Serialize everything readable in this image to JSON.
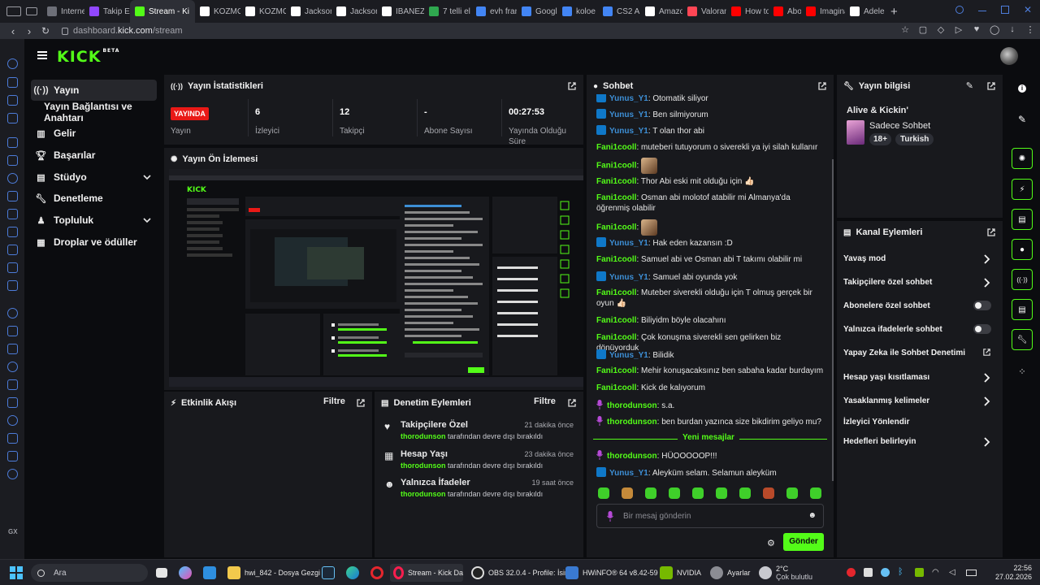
{
  "browser": {
    "tabs": [
      {
        "label": "Internet",
        "color": "#6d6f78"
      },
      {
        "label": "Takip Ed",
        "color": "#9147ff"
      },
      {
        "label": "Stream - Ki",
        "color": "#53fc18"
      },
      {
        "label": "KOZMO",
        "color": "#ffffff"
      },
      {
        "label": "KOZMO",
        "color": "#ffffff"
      },
      {
        "label": "Jackson",
        "color": "#ffffff"
      },
      {
        "label": "Jackson",
        "color": "#ffffff"
      },
      {
        "label": "IBANEZ",
        "color": "#ffffff"
      },
      {
        "label": "7 telli el",
        "color": "#2fa84f"
      },
      {
        "label": "evh fran",
        "color": "#4285f4"
      },
      {
        "label": "Google",
        "color": "#4285f4"
      },
      {
        "label": "koloe -",
        "color": "#4285f4"
      },
      {
        "label": "CS2 All",
        "color": "#4285f4"
      },
      {
        "label": "Amazon",
        "color": "#ffffff"
      },
      {
        "label": "Valorant",
        "color": "#ff4655"
      },
      {
        "label": "How to",
        "color": "#ff0000"
      },
      {
        "label": "Abo",
        "color": "#ff0000"
      },
      {
        "label": "Imagina",
        "color": "#ff0000"
      },
      {
        "label": "Adele -",
        "color": "#ffffff"
      }
    ],
    "url_prefix": "dashboard.",
    "url_domain": "kick.com",
    "url_path": "/stream"
  },
  "header": {
    "logo": "KICK",
    "logo_beta": "BETA"
  },
  "nav": {
    "items": [
      {
        "label": "Yayın",
        "icon": "broadcast-icon"
      },
      {
        "label": "Yayın Bağlantısı ve Anahtarı",
        "icon": ""
      },
      {
        "label": "Gelir",
        "icon": "chart-icon"
      },
      {
        "label": "Başarılar",
        "icon": "trophy-icon"
      },
      {
        "label": "Stüdyo",
        "icon": "studio-icon"
      },
      {
        "label": "Denetleme",
        "icon": "wrench-icon"
      },
      {
        "label": "Topluluk",
        "icon": "community-icon"
      },
      {
        "label": "Droplar ve ödüller",
        "icon": "drops-icon"
      }
    ]
  },
  "stats": {
    "title": "Yayın İstatistikleri",
    "live_label": "YAYINDA",
    "cells": [
      {
        "value": "",
        "label": "Yayın"
      },
      {
        "value": "6",
        "label": "İzleyici"
      },
      {
        "value": "12",
        "label": "Takipçi"
      },
      {
        "value": "-",
        "label": "Abone Sayısı"
      },
      {
        "value": "00:27:53",
        "label": "Yayında Olduğu Süre"
      }
    ]
  },
  "preview": {
    "title": "Yayın Ön İzlemesi"
  },
  "activity": {
    "title": "Etkinlik Akışı",
    "filter": "Filtre"
  },
  "mod_actions": {
    "title": "Denetim Eylemleri",
    "filter": "Filtre",
    "items": [
      {
        "title": "Takipçilere Özel",
        "time": "21 dakika önce",
        "user": "thorodunson",
        "text": "tarafından devre dışı bırakıldı",
        "icon": "heart-icon"
      },
      {
        "title": "Hesap Yaşı",
        "time": "23 dakika önce",
        "user": "thorodunson",
        "text": "tarafından devre dışı bırakıldı",
        "icon": "calendar-icon"
      },
      {
        "title": "Yalnızca İfadeler",
        "time": "19 saat önce",
        "user": "thorodunson",
        "text": "tarafından devre dışı bırakıldı",
        "icon": "smiley-icon"
      }
    ]
  },
  "chat": {
    "title": "Sohbet",
    "messages": [
      {
        "user": "Yunus_Y1",
        "text": "Otomatik siliyor",
        "type": "badge"
      },
      {
        "user": "Yunus_Y1",
        "text": "Ben silmiyorum",
        "type": "badge"
      },
      {
        "user": "Yunus_Y1",
        "text": "T olan thor abi",
        "type": "badge"
      },
      {
        "user": "Fani1cooll",
        "text": "muteberi tutuyorum o siverekli ya iyi silah kullanır",
        "type": "plain"
      },
      {
        "user": "Fani1cooll",
        "text": "",
        "type": "emote"
      },
      {
        "user": "Fani1cooll",
        "text": "Thor Abi eski mit olduğu için 👍🏻",
        "type": "plain"
      },
      {
        "user": "Fani1cooll",
        "text": "Osman abi molotof atabilir mi Almanya'da öğrenmiş olabilir",
        "type": "plain"
      },
      {
        "user": "Fani1cooll",
        "text": "",
        "type": "emote"
      },
      {
        "user": "Yunus_Y1",
        "text": "Hak eden kazansın :D",
        "type": "badge"
      },
      {
        "user": "Fani1cooll",
        "text": "Samuel abi ve Osman abi T takımı olabilir mi",
        "type": "plain"
      },
      {
        "user": "Yunus_Y1",
        "text": "Samuel abi oyunda yok",
        "type": "badge"
      },
      {
        "user": "Fani1cooll",
        "text": "Muteber siverekli olduğu için T olmuş gerçek bir oyun 👍🏻",
        "type": "plain"
      },
      {
        "user": "Fani1cooll",
        "text": "Biliyidm böyle olacahını",
        "type": "plain"
      },
      {
        "user": "Fani1cooll",
        "text": "Çok konuşma siverekli sen gelirken biz dönüyorduk",
        "type": "plain"
      },
      {
        "user": "Yunus_Y1",
        "text": "Bilidik",
        "type": "badge"
      },
      {
        "user": "Fani1cooll",
        "text": "Mehir konuşacaksınız ben sabaha kadar burdayım",
        "type": "plain"
      },
      {
        "user": "Fani1cooll",
        "text": "Kick de kalıyorum",
        "type": "plain"
      },
      {
        "user": "thorodunson",
        "text": "s.a.",
        "type": "mic"
      },
      {
        "user": "thorodunson",
        "text": "ben burdan yazınca size bikdirim geliyo mu?",
        "type": "mic"
      },
      {
        "user": "thorodunson",
        "text": "HÜOOOOOP!!!",
        "type": "mic"
      },
      {
        "user": "Yunus_Y1",
        "text": "Aleyküm selam. Selamun aleyküm",
        "type": "badge"
      }
    ],
    "new_messages": "Yeni mesajlar",
    "input_placeholder": "Bir mesaj gönderin",
    "send": "Gönder"
  },
  "stream_info": {
    "title": "Yayın bilgisi",
    "stream_title": "Alive & Kickin'",
    "category": "Sadece Sohbet",
    "tags": [
      "18+",
      "Turkish"
    ]
  },
  "channel_actions": {
    "title": "Kanal Eylemleri",
    "items": [
      {
        "label": "Yavaş mod",
        "control": "chevron"
      },
      {
        "label": "Takipçilere özel sohbet",
        "control": "chevron"
      },
      {
        "label": "Abonelere özel sohbet",
        "control": "toggle"
      },
      {
        "label": "Yalnızca ifadelerle sohbet",
        "control": "toggle"
      },
      {
        "label": "Yapay Zeka ile Sohbet Denetimi",
        "control": "external"
      },
      {
        "label": "Hesap yaşı kısıtlaması",
        "control": "chevron"
      },
      {
        "label": "Yasaklanmış kelimeler",
        "control": "chevron"
      },
      {
        "label": "İzleyici Yönlendir",
        "control": "none"
      },
      {
        "label": "Hedefleri belirleyin",
        "control": "chevron"
      }
    ]
  },
  "taskbar": {
    "search": "Ara",
    "items": [
      {
        "label": "hwi_842 - Dosya Gezgi"
      },
      {
        "label": "Stream - Kick Da"
      },
      {
        "label": "OBS 32.0.4 - Profile: İsin"
      },
      {
        "label": "HWiNFO® 64 v8.42-59"
      },
      {
        "label": "NVIDIA"
      },
      {
        "label": "Ayarlar"
      }
    ],
    "weather_temp": "2°C",
    "weather_desc": "Çok bulutlu",
    "time": "22:56",
    "date": "27.02.2026"
  },
  "colors": {
    "accent": "#53fc18",
    "live": "#e91916",
    "badge": "#0f78c8",
    "username_green": "#53fc18",
    "username_blue": "#3d8fd6"
  }
}
